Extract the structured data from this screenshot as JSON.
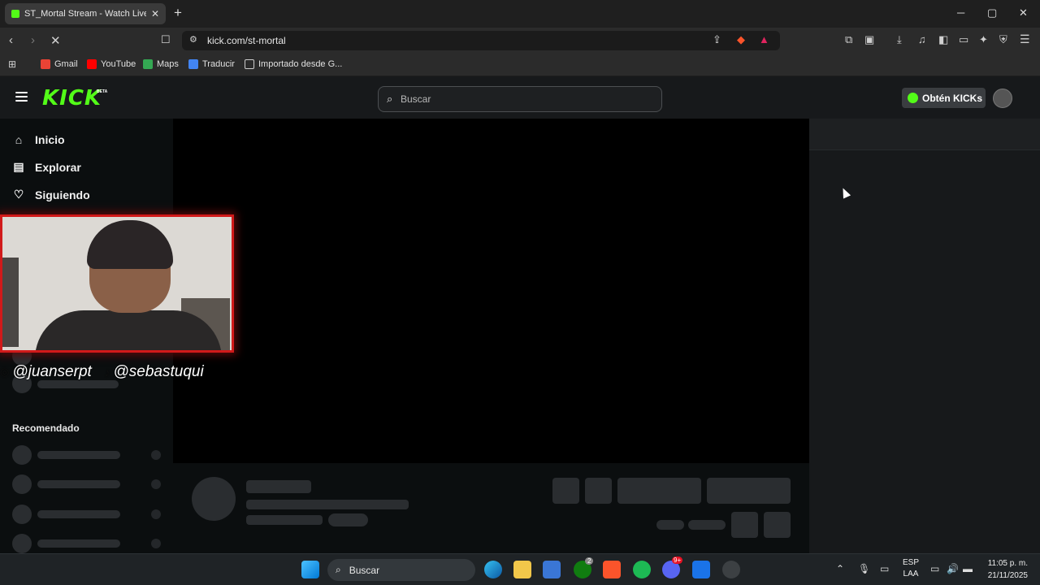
{
  "browser": {
    "tab_title": "ST_Mortal Stream - Watch Live o",
    "new_tab": "+",
    "url": "kick.com/st-mortal",
    "window_controls": {
      "minimize": "─",
      "maximize": "▢",
      "close": "✕"
    }
  },
  "bookmarks": [
    {
      "label": "Gmail",
      "color": "#ea4335"
    },
    {
      "label": "YouTube",
      "color": "#ff0000"
    },
    {
      "label": "Maps",
      "color": "#34a853"
    },
    {
      "label": "Traducir",
      "color": "#4285f4"
    },
    {
      "label": "Importado desde G...",
      "color": "#cccccc"
    }
  ],
  "kick": {
    "logo": "KICK",
    "beta": "BETA",
    "search_placeholder": "Buscar",
    "kicks_button": "Obtén KICKs",
    "accent": "#53fc18"
  },
  "sidebar": {
    "items": [
      {
        "label": "Inicio",
        "icon": "home-icon"
      },
      {
        "label": "Explorar",
        "icon": "compass-icon"
      },
      {
        "label": "Siguiendo",
        "icon": "heart-icon"
      }
    ],
    "recommended_heading": "Recomendado"
  },
  "webcam": {
    "handle_instagram": "@juanserpt",
    "handle_tiktok": "@sebastuqui"
  },
  "taskbar": {
    "search_placeholder": "Buscar",
    "language": "ESP",
    "language_sub": "LAA",
    "time": "11:05 p. m.",
    "date": "21/11/2025",
    "xbox_badge": "2",
    "discord_badge": "9+"
  }
}
